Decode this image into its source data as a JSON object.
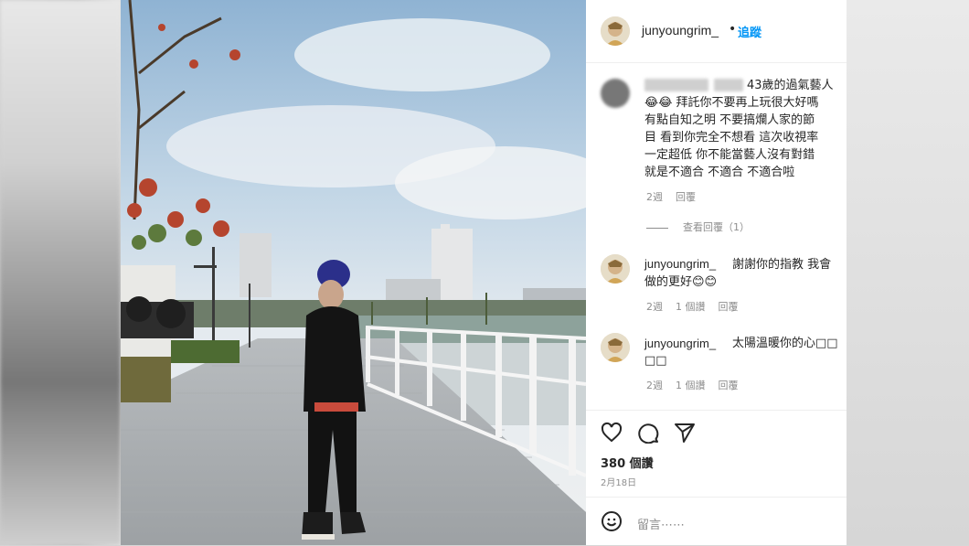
{
  "post": {
    "username": "junyoungrim_",
    "separator": "•",
    "follow_label": "追蹤"
  },
  "comments": [
    {
      "text_line1": "43歲的過氣藝人",
      "text_rest": [
        "😂😂 拜託你不要再上玩很大好嗎",
        "有點自知之明 不要搞爛人家的節",
        "目 看到你完全不想看 這次收視率",
        "一定超低 你不能當藝人沒有對錯",
        "就是不適合 不適合 不適合啦"
      ],
      "time": "2週",
      "reply_label": "回覆",
      "view_replies": "查看回覆（1）"
    },
    {
      "username": "junyoungrim_",
      "text_line1": "謝謝你的指教 我會",
      "text_line2": "做的更好😊😊",
      "time": "2週",
      "likes": "1 個讚",
      "reply_label": "回覆"
    },
    {
      "username": "junyoungrim_",
      "text_line1": "太陽溫暖你的心□□",
      "text_line2": "□□",
      "time": "2週",
      "likes": "1 個讚",
      "reply_label": "回覆"
    }
  ],
  "actions": {
    "like_icon": "heart-icon",
    "comment_icon": "comment-bubble-icon",
    "share_icon": "paper-plane-icon",
    "likes_count": "380 個讚",
    "date": "2月18日"
  },
  "comment_input": {
    "emoji_icon": "emoji-icon",
    "placeholder": "留言⋯⋯"
  },
  "colors": {
    "link": "#0095f6",
    "text": "#262626",
    "muted": "#8e8e8e"
  }
}
